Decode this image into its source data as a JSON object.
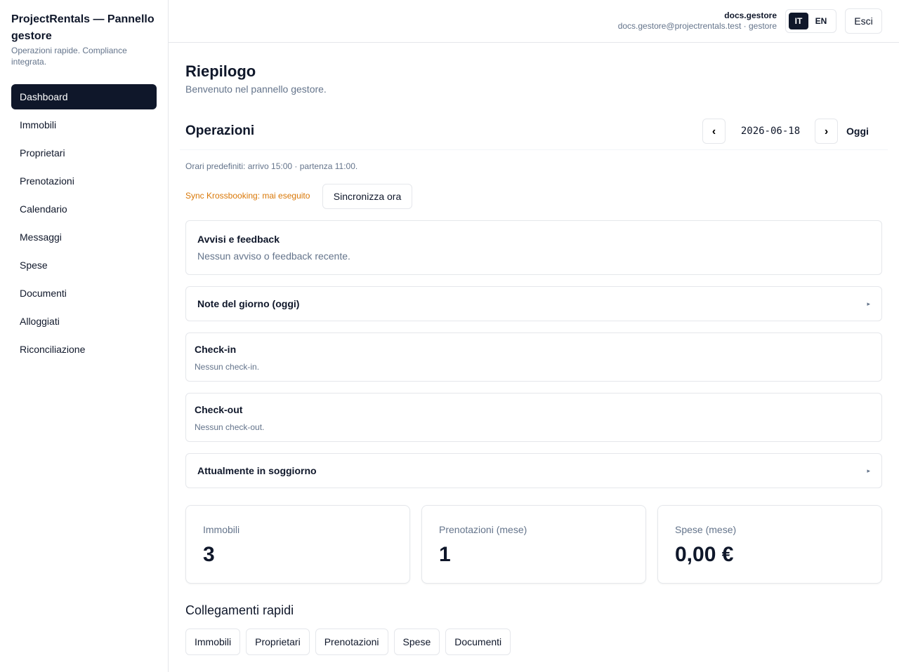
{
  "brand": {
    "title": "ProjectRentals — Pannello gestore",
    "subtitle": "Operazioni rapide. Compliance integrata."
  },
  "sidebar": {
    "items": [
      {
        "label": "Dashboard",
        "active": true
      },
      {
        "label": "Immobili"
      },
      {
        "label": "Proprietari"
      },
      {
        "label": "Prenotazioni"
      },
      {
        "label": "Calendario"
      },
      {
        "label": "Messaggi"
      },
      {
        "label": "Spese"
      },
      {
        "label": "Documenti"
      },
      {
        "label": "Alloggiati"
      },
      {
        "label": "Riconciliazione"
      }
    ]
  },
  "header": {
    "username": "docs.gestore",
    "user_meta": "docs.gestore@projectrentals.test · gestore",
    "lang": {
      "it": "IT",
      "en": "EN",
      "active": "IT"
    },
    "logout_label": "Esci"
  },
  "page": {
    "title": "Riepilogo",
    "subtitle": "Benvenuto nel pannello gestore."
  },
  "operations": {
    "title": "Operazioni",
    "prev_label": "‹",
    "next_label": "›",
    "date": "2026-06-18",
    "today_label": "Oggi",
    "default_times": "Orari predefiniti: arrivo 15:00 · partenza 11:00.",
    "sync_status": "Sync Krossbooking: mai eseguito",
    "sync_button": "Sincronizza ora",
    "alerts": {
      "title": "Avvisi e feedback",
      "text": "Nessun avviso o feedback recente."
    },
    "notes": {
      "title": "Note del giorno (oggi)",
      "caret": "▸"
    },
    "checkin": {
      "title": "Check-in",
      "text": "Nessun check-in."
    },
    "checkout": {
      "title": "Check-out",
      "text": "Nessun check-out."
    },
    "in_stay": {
      "title": "Attualmente in soggiorno",
      "caret": "▸"
    }
  },
  "stats": [
    {
      "label": "Immobili",
      "value": "3"
    },
    {
      "label": "Prenotazioni (mese)",
      "value": "1"
    },
    {
      "label": "Spese (mese)",
      "value": "0,00 €"
    }
  ],
  "quick_links": {
    "title": "Collegamenti rapidi",
    "items": [
      "Immobili",
      "Proprietari",
      "Prenotazioni",
      "Spese",
      "Documenti"
    ]
  },
  "colors": {
    "primary": "#0f172a",
    "muted": "#64748b",
    "border": "#e5e7eb",
    "warning": "#d97706"
  }
}
